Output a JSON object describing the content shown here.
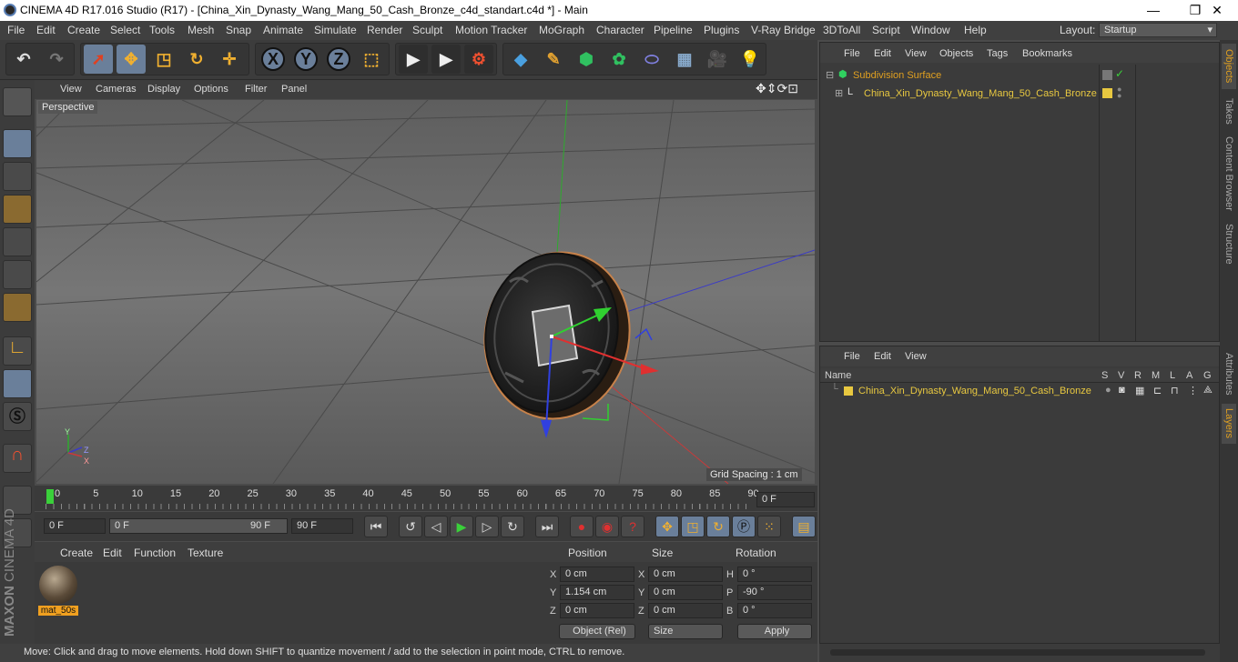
{
  "window": {
    "title": "CINEMA 4D R17.016 Studio (R17) - [China_Xin_Dynasty_Wang_Mang_50_Cash_Bronze_c4d_standart.c4d *] - Main",
    "minimize": "—",
    "maximize": "❐",
    "close": "✕"
  },
  "menu": [
    "File",
    "Edit",
    "Create",
    "Select",
    "Tools",
    "Mesh",
    "Snap",
    "Animate",
    "Simulate",
    "Render",
    "Sculpt",
    "Motion Tracker",
    "MoGraph",
    "Character",
    "Pipeline",
    "Plugins",
    "V-Ray Bridge",
    "3DToAll",
    "Script",
    "Window",
    "Help"
  ],
  "layout": {
    "label": "Layout:",
    "value": "Startup"
  },
  "axis_buttons": [
    "X",
    "Y",
    "Z"
  ],
  "viewport": {
    "menu": [
      "View",
      "Cameras",
      "Display",
      "Options",
      "Filter",
      "Panel"
    ],
    "camera": "Perspective",
    "grid_spacing": "Grid Spacing : 1 cm",
    "axis": {
      "x": "X",
      "y": "Y",
      "z": "Z"
    }
  },
  "timeline": {
    "ticks": [
      "0",
      "5",
      "10",
      "15",
      "20",
      "25",
      "30",
      "35",
      "40",
      "45",
      "50",
      "55",
      "60",
      "65",
      "70",
      "75",
      "80",
      "85",
      "90"
    ],
    "current_frame": "0 F"
  },
  "transport": {
    "start": "0 F",
    "range_start": "0 F",
    "range_end": "90 F",
    "end": "90 F"
  },
  "materials": {
    "menu": [
      "Create",
      "Edit",
      "Function",
      "Texture"
    ],
    "items": [
      {
        "name": "mat_50s"
      }
    ]
  },
  "coords": {
    "headers": [
      "Position",
      "Size",
      "Rotation"
    ],
    "rows": [
      {
        "axis": "X",
        "pos": "0 cm",
        "saxis": "X",
        "size": "0 cm",
        "raxis": "H",
        "rot": "0 °"
      },
      {
        "axis": "Y",
        "pos": "1.154 cm",
        "saxis": "Y",
        "size": "0 cm",
        "raxis": "P",
        "rot": "-90 °"
      },
      {
        "axis": "Z",
        "pos": "0 cm",
        "saxis": "Z",
        "size": "0 cm",
        "raxis": "B",
        "rot": "0 °"
      }
    ],
    "mode": "Object (Rel)",
    "size_mode": "Size",
    "apply": "Apply"
  },
  "status": "Move: Click and drag to move elements. Hold down SHIFT to quantize movement / add to the selection in point mode, CTRL to remove.",
  "objects": {
    "menu": [
      "File",
      "Edit",
      "View",
      "Objects",
      "Tags",
      "Bookmarks"
    ],
    "items": [
      {
        "name": "Subdivision Surface",
        "color": "#e0a020"
      },
      {
        "name": "China_Xin_Dynasty_Wang_Mang_50_Cash_Bronze",
        "color": "#e8c840"
      }
    ]
  },
  "layers": {
    "menu": [
      "File",
      "Edit",
      "View"
    ],
    "columns": [
      "Name",
      "S",
      "V",
      "R",
      "M",
      "L",
      "A",
      "G"
    ],
    "items": [
      {
        "name": "China_Xin_Dynasty_Wang_Mang_50_Cash_Bronze",
        "color": "#e8c840"
      }
    ]
  },
  "side_tabs": [
    "Objects",
    "Takes",
    "Content Browser",
    "Structure",
    "Attributes",
    "Layers"
  ],
  "logo": {
    "brand": "MAXON",
    "product": "CINEMA 4D"
  }
}
